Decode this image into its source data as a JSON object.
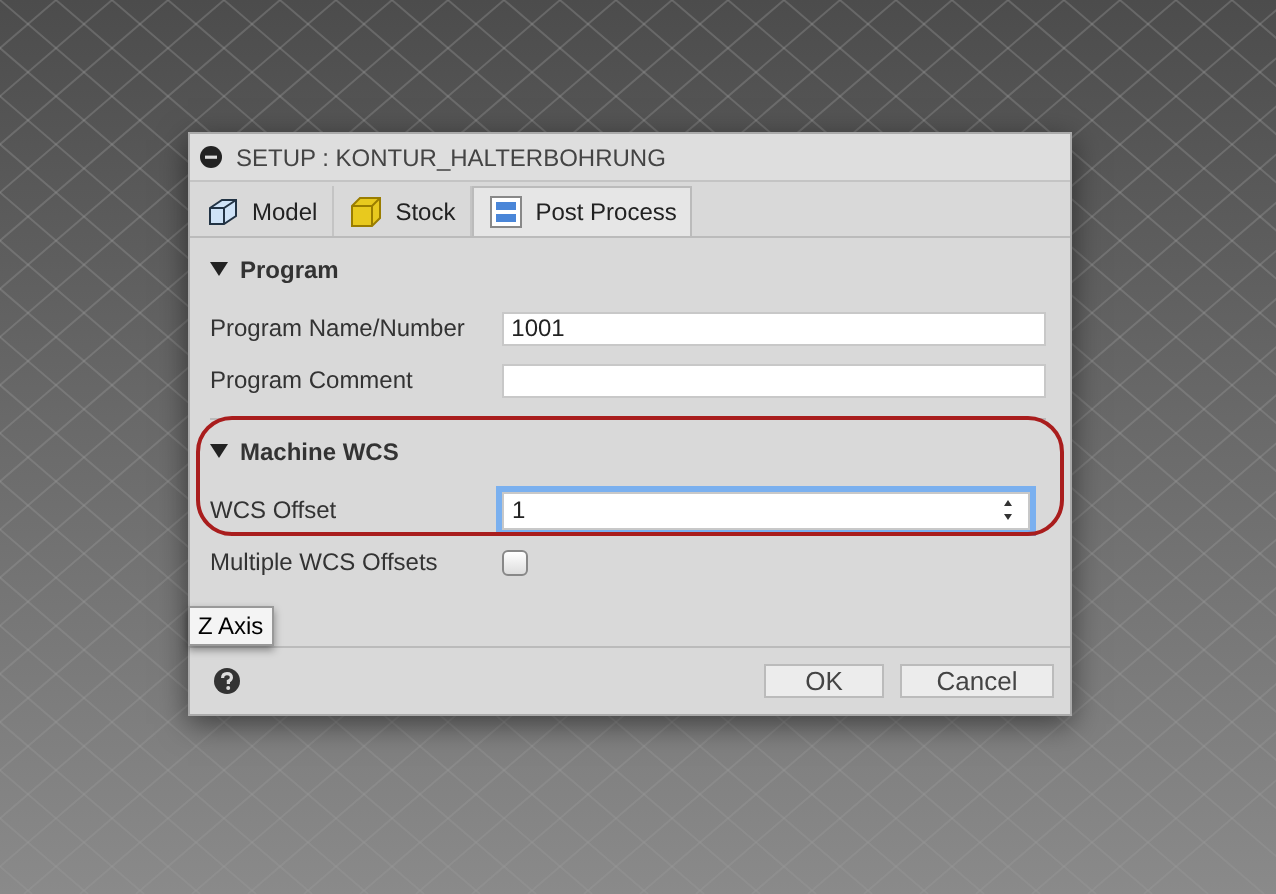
{
  "dialog": {
    "title": "SETUP : KONTUR_HALTERBOHRUNG",
    "tabs": [
      {
        "label": "Model",
        "selected": false,
        "kind": "model"
      },
      {
        "label": "Stock",
        "selected": false,
        "kind": "stock"
      },
      {
        "label": "Post Process",
        "selected": true,
        "kind": "post"
      }
    ],
    "sections": [
      {
        "title": "Program",
        "expanded": true,
        "highlighted": false,
        "fields": [
          {
            "kind": "text",
            "label": "Program Name/Number",
            "value": "1001",
            "focused": false
          },
          {
            "kind": "text",
            "label": "Program Comment",
            "focused": false
          }
        ]
      },
      {
        "title": "Machine WCS",
        "expanded": true,
        "highlighted": true,
        "fields": [
          {
            "kind": "spinner",
            "label": "WCS Offset",
            "value": "1",
            "focused": true
          },
          {
            "kind": "checkbox",
            "label": "Multiple WCS Offsets",
            "checked": false
          }
        ]
      }
    ],
    "tooltip": "Z Axis",
    "buttons": [
      "OK",
      "Cancel"
    ]
  }
}
